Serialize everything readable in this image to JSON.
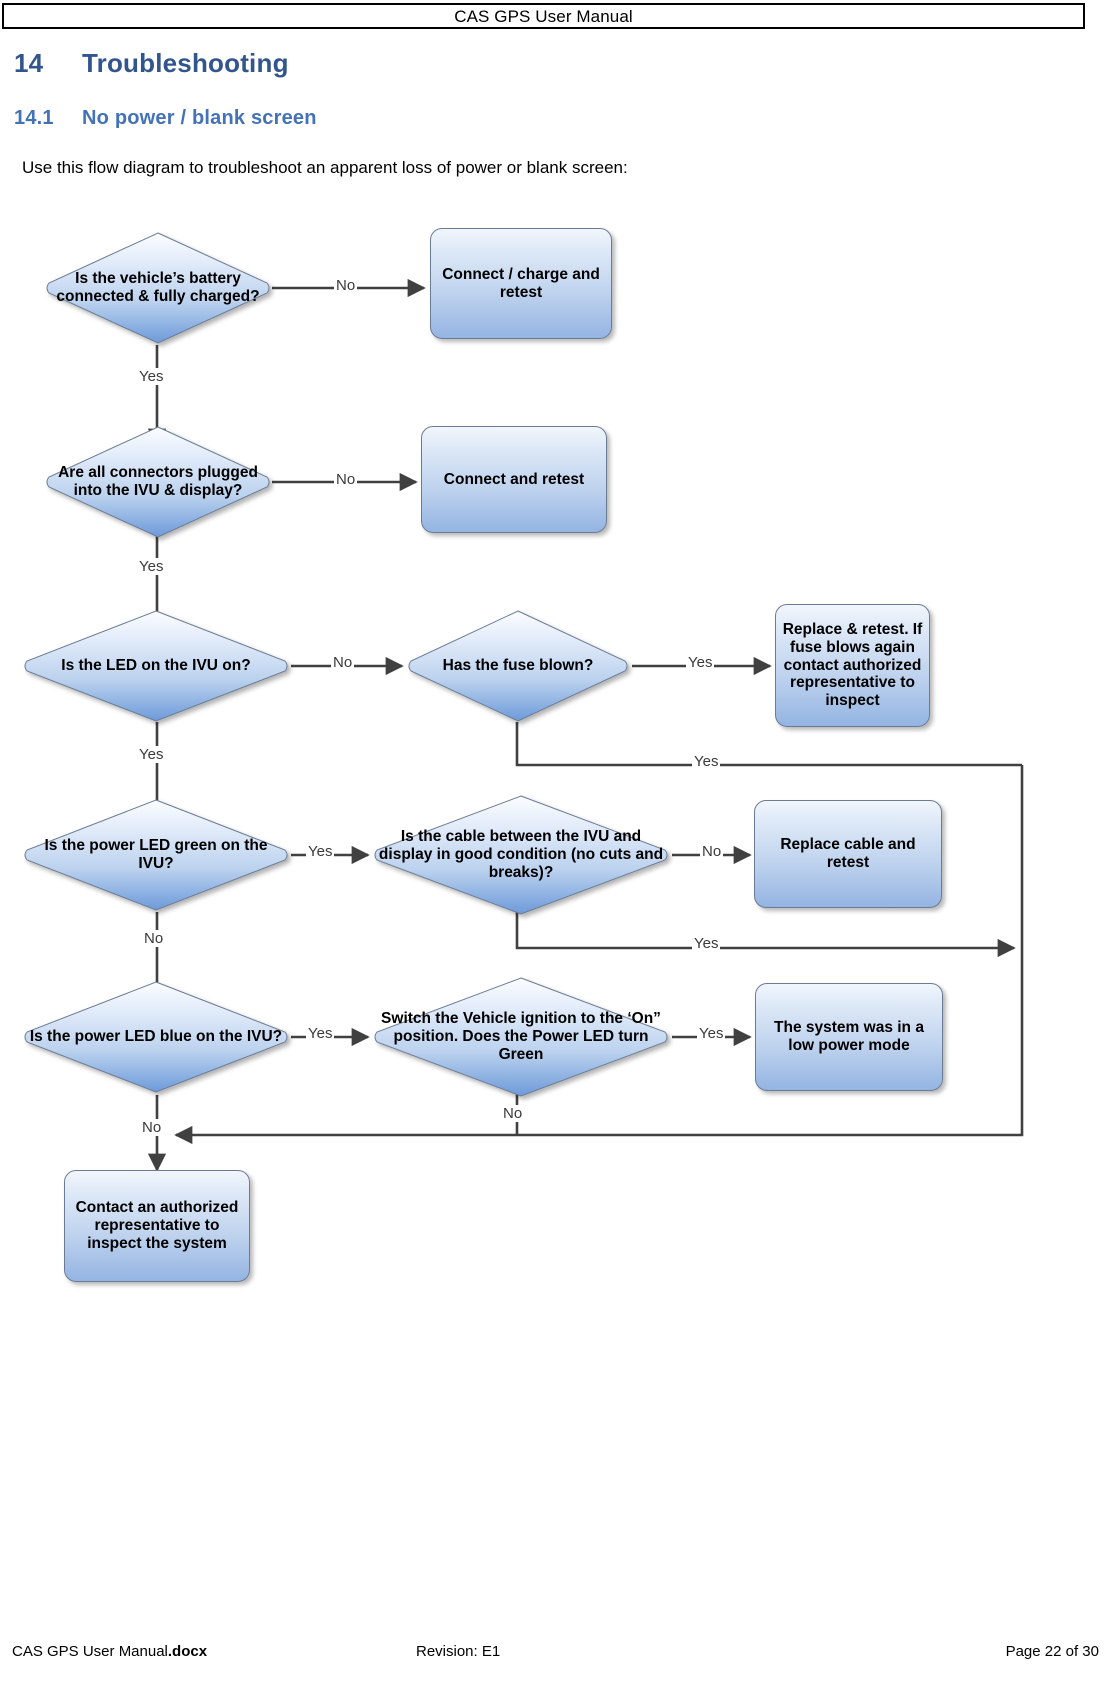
{
  "header": {
    "title": "CAS GPS User Manual"
  },
  "headings": {
    "section_number": "14",
    "section_title": "Troubleshooting",
    "subsection_number": "14.1",
    "subsection_title": "No power / blank screen"
  },
  "intro": "Use this flow diagram to troubleshoot an apparent loss of power or blank screen:",
  "footer": {
    "file_name": "CAS GPS User Manual",
    "file_ext": ".docx",
    "revision": "Revision: E1",
    "page": "Page 22 of 30"
  },
  "colors": {
    "heading_1": "#31558C",
    "heading_2": "#4472B8",
    "shape_fill_top": "#f2f6fc",
    "shape_fill_bottom": "#94b4e2",
    "shape_border": "#6b7b93",
    "connector": "#404040"
  },
  "chart_data": {
    "type": "diagram",
    "title": "No power / blank screen troubleshooting flow",
    "nodes": [
      {
        "id": "d1",
        "shape": "decision",
        "text": "Is the vehicle’s battery connected & fully charged?"
      },
      {
        "id": "p1",
        "shape": "process",
        "text": "Connect / charge and retest"
      },
      {
        "id": "d2",
        "shape": "decision",
        "text": "Are all connectors plugged into the IVU & display?"
      },
      {
        "id": "p2",
        "shape": "process",
        "text": "Connect and retest"
      },
      {
        "id": "d3",
        "shape": "decision",
        "text": "Is the LED on the IVU on?"
      },
      {
        "id": "d4",
        "shape": "decision",
        "text": "Has the fuse blown?"
      },
      {
        "id": "p3",
        "shape": "process",
        "text": "Replace & retest. If fuse blows again contact authorized representative to inspect"
      },
      {
        "id": "d5",
        "shape": "decision",
        "text": "Is the power LED green on the IVU?"
      },
      {
        "id": "d6",
        "shape": "decision",
        "text": "Is the cable between the IVU and display in good condition (no cuts and breaks)?"
      },
      {
        "id": "p4",
        "shape": "process",
        "text": "Replace cable and retest"
      },
      {
        "id": "d7",
        "shape": "decision",
        "text": "Is the power LED blue on the IVU?"
      },
      {
        "id": "d8",
        "shape": "decision",
        "text": "Switch the Vehicle ignition to the ‘On” position. Does the Power LED turn Green"
      },
      {
        "id": "p5",
        "shape": "process",
        "text": "The system was in a low power mode"
      },
      {
        "id": "p6",
        "shape": "process",
        "text": "Contact an authorized representative to inspect the system"
      }
    ],
    "edges": [
      {
        "from": "d1",
        "to": "p1",
        "label": "No"
      },
      {
        "from": "d1",
        "to": "d2",
        "label": "Yes"
      },
      {
        "from": "d2",
        "to": "p2",
        "label": "No"
      },
      {
        "from": "d2",
        "to": "d3",
        "label": "Yes"
      },
      {
        "from": "d3",
        "to": "d4",
        "label": "No"
      },
      {
        "from": "d3",
        "to": "d5",
        "label": "Yes"
      },
      {
        "from": "d4",
        "to": "p3",
        "label": "Yes"
      },
      {
        "from": "d4",
        "to": "p6",
        "label": "Yes"
      },
      {
        "from": "d5",
        "to": "d6",
        "label": "Yes"
      },
      {
        "from": "d5",
        "to": "d7",
        "label": "No"
      },
      {
        "from": "d6",
        "to": "p4",
        "label": "No"
      },
      {
        "from": "d6",
        "to": "p6",
        "label": "Yes"
      },
      {
        "from": "d7",
        "to": "d8",
        "label": "Yes"
      },
      {
        "from": "d7",
        "to": "p6",
        "label": "No"
      },
      {
        "from": "d8",
        "to": "p5",
        "label": "Yes"
      },
      {
        "from": "d8",
        "to": "p6",
        "label": "No"
      }
    ],
    "edge_labels": {
      "d1_no": "No",
      "d1_yes": "Yes",
      "d2_no": "No",
      "d2_yes": "Yes",
      "d3_no": "No",
      "d3_yes": "Yes",
      "d4_yes": "Yes",
      "d4_yes_loop": "Yes",
      "d5_yes": "Yes",
      "d5_no": "No",
      "d6_no": "No",
      "d6_yes_loop": "Yes",
      "d7_yes": "Yes",
      "d7_no": "No",
      "d8_yes": "Yes",
      "d8_no": "No"
    }
  }
}
